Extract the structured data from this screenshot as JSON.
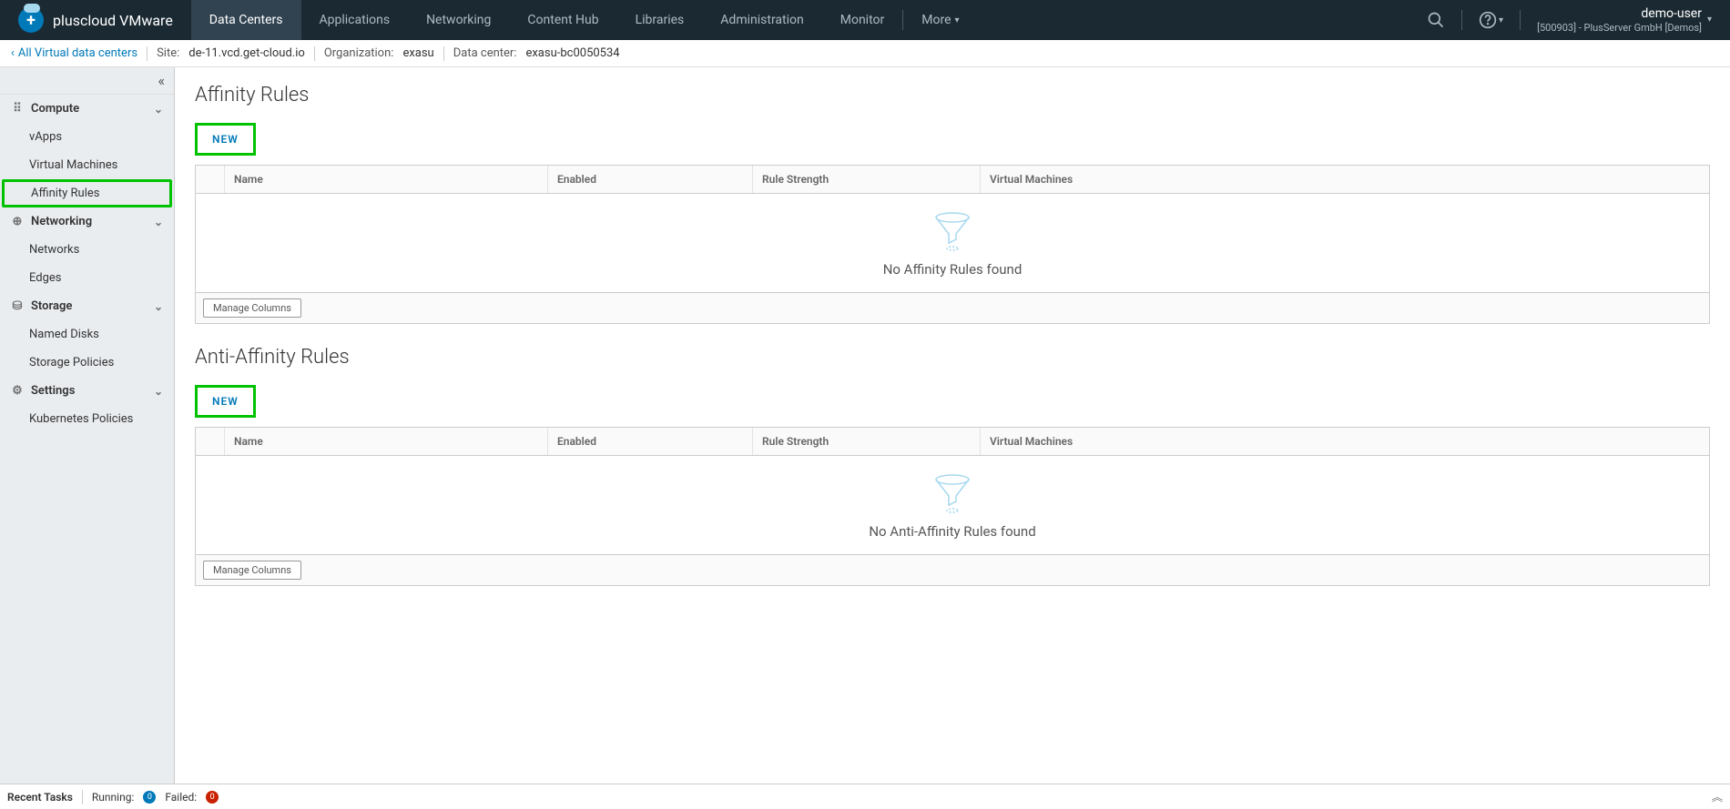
{
  "brand": "pluscloud VMware",
  "nav": {
    "tabs": [
      "Data Centers",
      "Applications",
      "Networking",
      "Content Hub",
      "Libraries",
      "Administration",
      "Monitor"
    ],
    "more": "More"
  },
  "user": {
    "name": "demo-user",
    "org": "[500903] - PlusServer GmbH [Demos]"
  },
  "breadcrumb": {
    "back": "All Virtual data centers",
    "site_label": "Site:",
    "site": "de-11.vcd.get-cloud.io",
    "org_label": "Organization:",
    "org": "exasu",
    "dc_label": "Data center:",
    "dc": "exasu-bc0050534"
  },
  "sidebar": {
    "sections": [
      {
        "label": "Compute",
        "items": [
          "vApps",
          "Virtual Machines",
          "Affinity Rules"
        ],
        "active": "Affinity Rules"
      },
      {
        "label": "Networking",
        "items": [
          "Networks",
          "Edges"
        ]
      },
      {
        "label": "Storage",
        "items": [
          "Named Disks",
          "Storage Policies"
        ]
      },
      {
        "label": "Settings",
        "items": [
          "Kubernetes Policies"
        ]
      }
    ]
  },
  "content": {
    "section1": {
      "title": "Affinity Rules",
      "new_btn": "NEW",
      "columns": [
        "",
        "Name",
        "Enabled",
        "Rule Strength",
        "Virtual Machines"
      ],
      "empty": "No Affinity Rules found",
      "manage": "Manage Columns"
    },
    "section2": {
      "title": "Anti-Affinity Rules",
      "new_btn": "NEW",
      "columns": [
        "",
        "Name",
        "Enabled",
        "Rule Strength",
        "Virtual Machines"
      ],
      "empty": "No Anti-Affinity Rules found",
      "manage": "Manage Columns"
    }
  },
  "status": {
    "recent": "Recent Tasks",
    "running_label": "Running:",
    "running": "0",
    "failed_label": "Failed:",
    "failed": "0"
  }
}
